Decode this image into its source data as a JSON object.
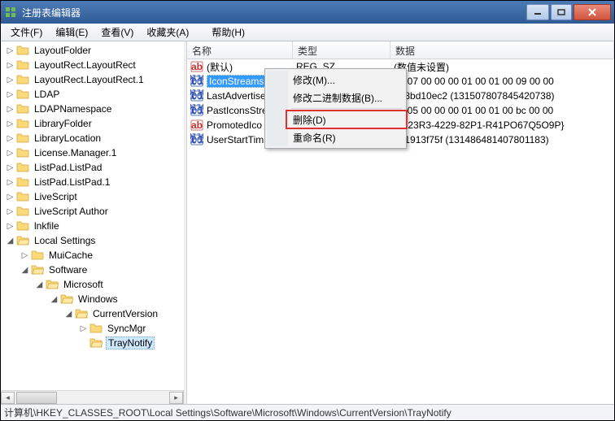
{
  "window": {
    "title": "注册表编辑器"
  },
  "menubar": [
    {
      "label": "文件(F)"
    },
    {
      "label": "编辑(E)"
    },
    {
      "label": "查看(V)"
    },
    {
      "label": "收藏夹(A)"
    },
    {
      "label": "帮助(H)"
    }
  ],
  "tree": [
    {
      "indent": 0,
      "toggle": "▷",
      "label": "LayoutFolder"
    },
    {
      "indent": 0,
      "toggle": "▷",
      "label": "LayoutRect.LayoutRect"
    },
    {
      "indent": 0,
      "toggle": "▷",
      "label": "LayoutRect.LayoutRect.1"
    },
    {
      "indent": 0,
      "toggle": "▷",
      "label": "LDAP"
    },
    {
      "indent": 0,
      "toggle": "▷",
      "label": "LDAPNamespace"
    },
    {
      "indent": 0,
      "toggle": "▷",
      "label": "LibraryFolder"
    },
    {
      "indent": 0,
      "toggle": "▷",
      "label": "LibraryLocation"
    },
    {
      "indent": 0,
      "toggle": "▷",
      "label": "License.Manager.1"
    },
    {
      "indent": 0,
      "toggle": "▷",
      "label": "ListPad.ListPad"
    },
    {
      "indent": 0,
      "toggle": "▷",
      "label": "ListPad.ListPad.1"
    },
    {
      "indent": 0,
      "toggle": "▷",
      "label": "LiveScript"
    },
    {
      "indent": 0,
      "toggle": "▷",
      "label": "LiveScript Author"
    },
    {
      "indent": 0,
      "toggle": "▷",
      "label": "lnkfile"
    },
    {
      "indent": 0,
      "toggle": "◢",
      "label": "Local Settings"
    },
    {
      "indent": 1,
      "toggle": "▷",
      "label": "MuiCache"
    },
    {
      "indent": 1,
      "toggle": "◢",
      "label": "Software"
    },
    {
      "indent": 2,
      "toggle": "◢",
      "label": "Microsoft"
    },
    {
      "indent": 3,
      "toggle": "◢",
      "label": "Windows"
    },
    {
      "indent": 4,
      "toggle": "◢",
      "label": "CurrentVersion"
    },
    {
      "indent": 5,
      "toggle": "▷",
      "label": "SyncMgr"
    },
    {
      "indent": 5,
      "toggle": "",
      "label": "TrayNotify",
      "selected": true
    }
  ],
  "list": {
    "columns": {
      "name": "名称",
      "type": "类型",
      "data": "数据"
    },
    "rows": [
      {
        "icon": "string",
        "name": "(默认)",
        "type": "REG_SZ",
        "data": "(数值未设置)"
      },
      {
        "icon": "binary",
        "name": "IconStreams",
        "type": "",
        "data": "          00 07 00 00 00 01 00 01 00 09 00 00",
        "selected": true
      },
      {
        "icon": "binary",
        "name": "LastAdvertise",
        "type": "",
        "data": "a78bd10ec2 (131507807845420738)"
      },
      {
        "icon": "binary",
        "name": "PastIconsStre",
        "type": "",
        "data": "          00 05 00 00 00 01 00 01 00 bc 00 00"
      },
      {
        "icon": "string",
        "name": "PromotedIco",
        "type": "",
        "data": "76-23R3-4229-82P1-R41PO67Q5O9P}"
      },
      {
        "icon": "binary",
        "name": "UserStartTim",
        "type": "",
        "data": "421913f75f (131486481407801183)"
      }
    ]
  },
  "contextmenu": [
    {
      "label": "修改(M)..."
    },
    {
      "label": "修改二进制数据(B)..."
    },
    {
      "sep": true
    },
    {
      "label": "删除(D)",
      "highlighted": true
    },
    {
      "label": "重命名(R)"
    }
  ],
  "statusbar": "计算机\\HKEY_CLASSES_ROOT\\Local Settings\\Software\\Microsoft\\Windows\\CurrentVersion\\TrayNotify"
}
